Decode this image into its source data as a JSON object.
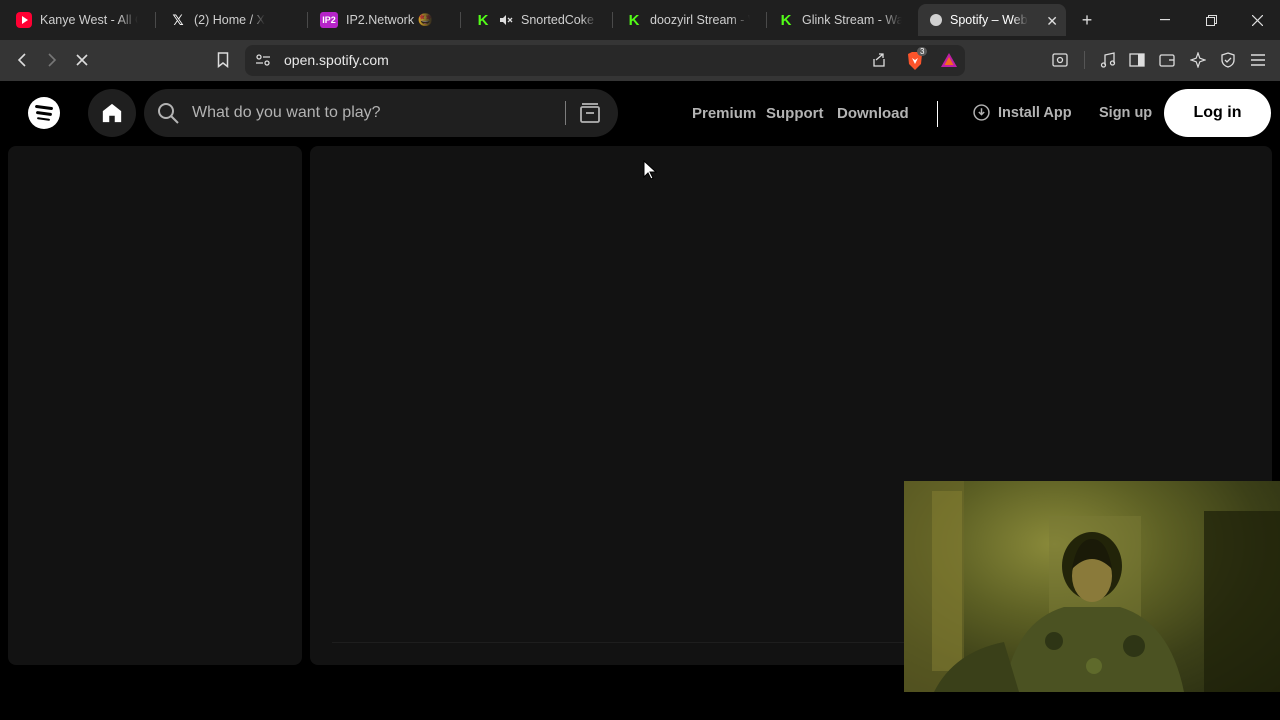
{
  "browser": {
    "tabs": [
      {
        "title": "Kanye West - All Of",
        "favicon": "youtube-icon",
        "active": false
      },
      {
        "title": "(2) Home / X",
        "favicon": "x-icon",
        "active": false
      },
      {
        "title": "IP2.Network 🤩",
        "favicon": "ip2-icon",
        "favicon_text": "IP2",
        "active": false
      },
      {
        "title": "SnortedCoke St",
        "favicon": "kick-icon",
        "muted": true,
        "active": false
      },
      {
        "title": "doozyirl Stream - W",
        "favicon": "kick-icon",
        "active": false
      },
      {
        "title": "Glink Stream - Wat",
        "favicon": "kick-icon",
        "active": false
      },
      {
        "title": "Spotify – Web",
        "favicon": "spotify-icon",
        "active": true
      }
    ],
    "url": "open.spotify.com",
    "shield_count": "3"
  },
  "spotify": {
    "search_placeholder": "What do you want to play?",
    "nav_links": {
      "premium": "Premium",
      "support": "Support",
      "download": "Download"
    },
    "install_app": "Install App",
    "sign_up": "Sign up",
    "log_in": "Log in"
  },
  "colors": {
    "tab_strip": "#1f1f1f",
    "toolbar": "#353535",
    "spotify_bg": "#000000",
    "panel": "#121212",
    "kick_green": "#53fc18"
  }
}
